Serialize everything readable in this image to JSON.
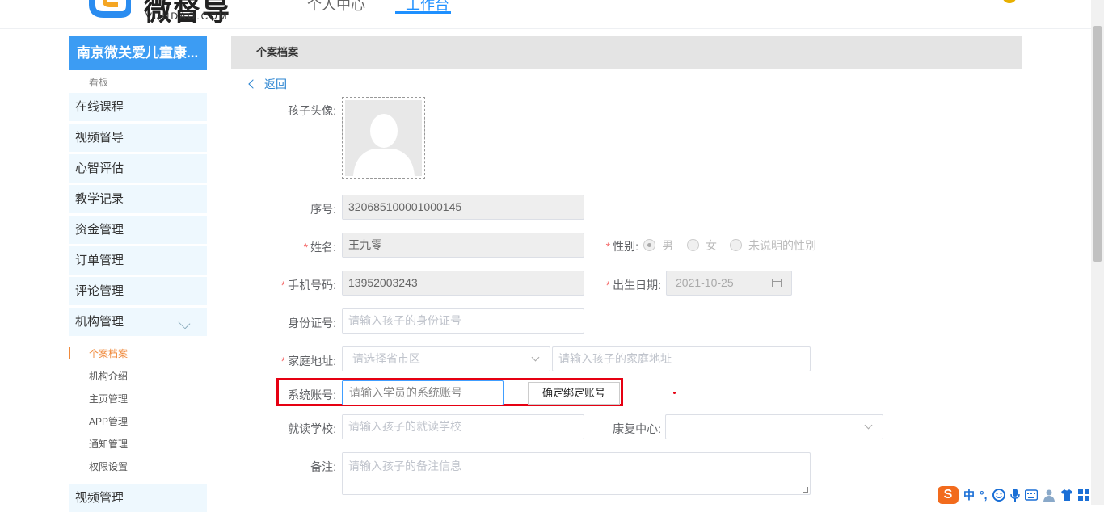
{
  "header": {
    "logo_text": "微督导",
    "logo_sub": "VDUDAO.COM",
    "nav": [
      {
        "label": "个人中心"
      },
      {
        "label": "工作台"
      }
    ]
  },
  "sidebar": {
    "org_title": "南京微关爱儿童康...",
    "dashboard": "看板",
    "items": [
      {
        "label": "在线课程"
      },
      {
        "label": "视频督导"
      },
      {
        "label": "心智评估"
      },
      {
        "label": "教学记录"
      },
      {
        "label": "资金管理"
      },
      {
        "label": "订单管理"
      },
      {
        "label": "评论管理"
      },
      {
        "label": "机构管理"
      }
    ],
    "sub_items": [
      {
        "label": "个案档案",
        "active": true
      },
      {
        "label": "机构介绍"
      },
      {
        "label": "主页管理"
      },
      {
        "label": "APP管理"
      },
      {
        "label": "通知管理"
      },
      {
        "label": "权限设置"
      }
    ],
    "bottom_item": "视频管理"
  },
  "main": {
    "panel_title": "个案档案",
    "back_label": "返回",
    "form": {
      "avatar_label": "孩子头像:",
      "serial_label": "序号:",
      "serial_value": "320685100001000145",
      "name_label": "姓名:",
      "name_value": "王九零",
      "gender_label": "性别:",
      "gender_options": [
        "男",
        "女",
        "未说明的性别"
      ],
      "gender_selected": "男",
      "phone_label": "手机号码:",
      "phone_value": "13952003243",
      "birth_label": "出生日期:",
      "birth_value": "2021-10-25",
      "id_label": "身份证号:",
      "id_placeholder": "请输入孩子的身份证号",
      "address_label": "家庭地址:",
      "region_placeholder": "请选择省市区",
      "address_placeholder": "请输入孩子的家庭地址",
      "account_label": "系统账号:",
      "account_placeholder": "请输入学员的系统账号",
      "bind_button": "确定绑定账号",
      "school_label": "就读学校:",
      "school_placeholder": "请输入孩子的就读学校",
      "center_label": "康复中心:",
      "center_value": "",
      "note_label": "备注:",
      "note_placeholder": "请输入孩子的备注信息"
    }
  },
  "ime_tray": {
    "logo": "S",
    "mode": "中",
    "punct": "°,"
  },
  "colors": {
    "accent": "#3c9cf3",
    "highlight_box": "#e60012",
    "active_sub": "#f08a3c",
    "required": "#f56c6c"
  }
}
